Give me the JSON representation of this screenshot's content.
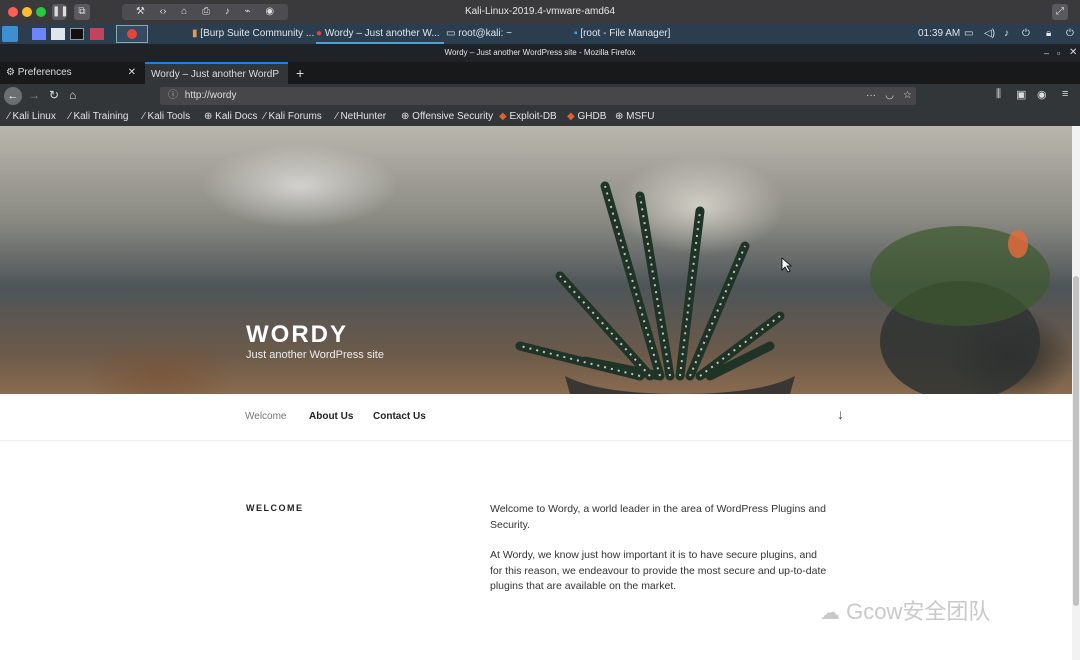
{
  "vm": {
    "title": "Kali-Linux-2019.4-vmware-amd64"
  },
  "panel": {
    "tasks": [
      {
        "label": "[Burp Suite Community ..."
      },
      {
        "label": "Wordy – Just another W..."
      },
      {
        "label": "root@kali: ~"
      },
      {
        "label": "[root - File Manager]"
      }
    ],
    "clock": "01:39 AM"
  },
  "firefox": {
    "window_title": "Wordy – Just another WordPress site - Mozilla Firefox",
    "tabs": [
      {
        "label": "Preferences"
      },
      {
        "label": "Wordy – Just another WordP"
      }
    ],
    "url": "http://wordy",
    "bookmarks": [
      {
        "label": "Kali Linux"
      },
      {
        "label": "Kali Training"
      },
      {
        "label": "Kali Tools"
      },
      {
        "label": "Kali Docs"
      },
      {
        "label": "Kali Forums"
      },
      {
        "label": "NetHunter"
      },
      {
        "label": "Offensive Security"
      },
      {
        "label": "Exploit-DB"
      },
      {
        "label": "GHDB"
      },
      {
        "label": "MSFU"
      }
    ]
  },
  "site": {
    "title": "WORDY",
    "tagline": "Just another WordPress site",
    "nav": [
      {
        "label": "Welcome"
      },
      {
        "label": "About Us"
      },
      {
        "label": "Contact Us"
      }
    ],
    "section_heading": "WELCOME",
    "paragraphs": [
      "Welcome to Wordy, a world leader in the area of WordPress Plugins and Security.",
      "At Wordy, we know just how important it is to have secure plugins, and for this reason, we endeavour to provide the most secure and up-to-date plugins that are available on the market."
    ]
  },
  "watermark": "Gcow安全团队",
  "colors": {
    "panel_bg": "#2b3e50",
    "browser_chrome": "#323639",
    "accent": "#4aa3df"
  }
}
